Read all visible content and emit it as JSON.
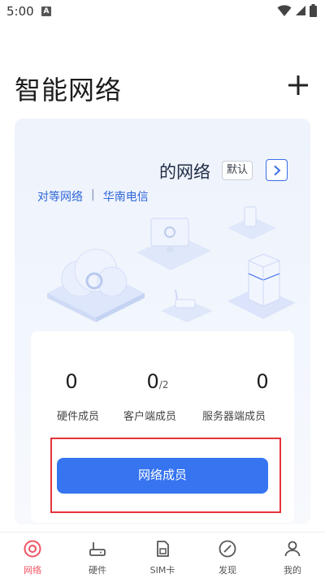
{
  "status_bar": {
    "time": "5:00",
    "notification_letter": "A"
  },
  "header": {
    "title": "智能网络"
  },
  "card": {
    "network_name": "的网络",
    "default_badge": "默认",
    "network_type": "对等网络",
    "separator": "|",
    "isp": "华南电信"
  },
  "stats": [
    {
      "value": "0",
      "suffix": "",
      "label": "硬件成员"
    },
    {
      "value": "0",
      "suffix": "/2",
      "label": "客户端成员"
    },
    {
      "value": "0",
      "suffix": "",
      "label": "服务器端成员"
    }
  ],
  "members_button": {
    "label": "网络成员"
  },
  "nav": [
    {
      "label": "网络",
      "icon": "network-icon",
      "active": true
    },
    {
      "label": "硬件",
      "icon": "router-icon",
      "active": false
    },
    {
      "label": "SIM卡",
      "icon": "sim-card-icon",
      "active": false
    },
    {
      "label": "发现",
      "icon": "compass-icon",
      "active": false
    },
    {
      "label": "我的",
      "icon": "profile-icon",
      "active": false
    }
  ],
  "colors": {
    "accent": "#3674f0",
    "nav_active": "#f05464",
    "highlight": "#e5343a"
  }
}
